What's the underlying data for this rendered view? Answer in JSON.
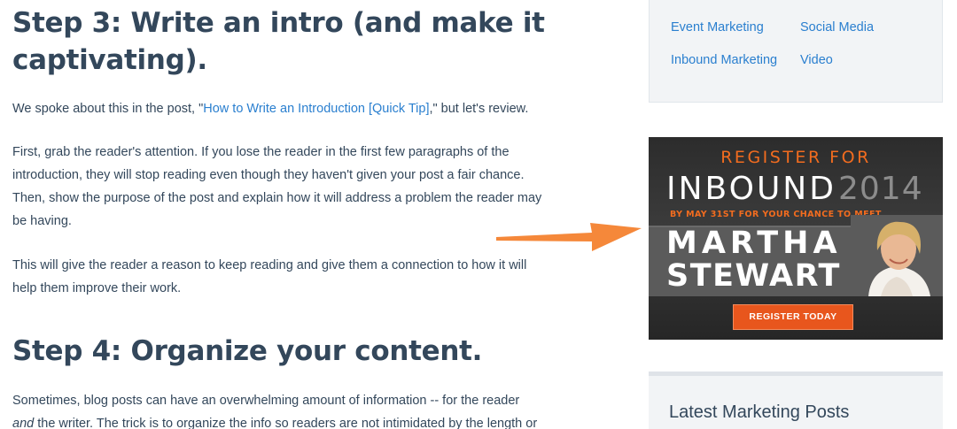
{
  "article": {
    "step3_heading_line1": "Step 3: Write an intro (and make it",
    "step3_heading_line2": "captivating).",
    "p1_before": "We spoke about this in the post, \"",
    "p1_link": "How to Write an Introduction [Quick Tip]",
    "p1_after": ",\" but let's review.",
    "p2_line1": "First, grab the reader's attention. If you lose the reader in the first few paragraphs of the",
    "p2_line2": "introduction, they will stop reading even though they haven't given your post a fair chance.",
    "p2_line3": "Then, show the purpose of the post and explain how it will address a problem the reader may",
    "p2_line4": "be having.",
    "p3_line1": "This will give the reader a reason to keep reading and give them a connection to how it will",
    "p3_line2": "help them improve their work.",
    "step4_heading": "Step 4: Organize your content.",
    "p4_line1": "Sometimes, blog posts can have an overwhelming amount of information -- for the reader",
    "p4_line2_em": "and",
    "p4_line2_rest": " the writer. The trick is to organize the info so readers are not intimidated by the length or"
  },
  "sidebar": {
    "topics": [
      "Event Marketing",
      "Social Media",
      "Inbound Marketing",
      "Video"
    ],
    "latest_title": "Latest Marketing Posts"
  },
  "ad": {
    "register_for": "REGISTER FOR",
    "inbound": "INBOUND",
    "year": "2014",
    "subline": "BY MAY 31ST FOR YOUR CHANCE TO MEET",
    "name_first": "MARTHA",
    "name_last": "STEWART",
    "button": "REGISTER TODAY"
  },
  "colors": {
    "heading": "#33475b",
    "link": "#2a7fcf",
    "accent_orange": "#f26c1f",
    "arrow": "#f5883a"
  },
  "icons": {
    "arrow": "right-arrow-icon"
  }
}
